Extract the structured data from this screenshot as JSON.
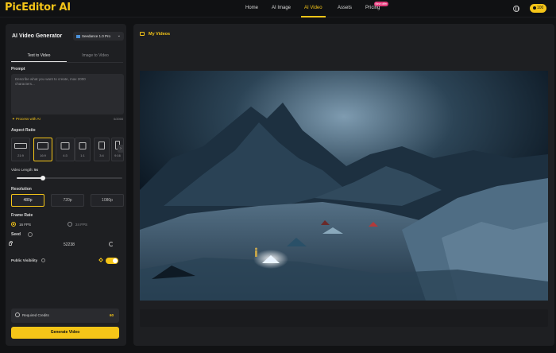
{
  "nav": {
    "logo": "PicEditor AI",
    "items": [
      {
        "label": "Home"
      },
      {
        "label": "AI Image"
      },
      {
        "label": "AI Video"
      },
      {
        "label": "Assets"
      },
      {
        "label": "Pricing"
      }
    ],
    "active_item": "AI Video",
    "pricing_badge": "New offer",
    "credits": "100"
  },
  "panel": {
    "title": "AI Video Generator",
    "model": "Seedance 1.0 Pro",
    "tabs": [
      {
        "label": "Text to Video"
      },
      {
        "label": "Image to Video"
      }
    ],
    "active_tab": "Text to Video",
    "prompt_label": "Prompt",
    "prompt_placeholder": "Describe what you want to create, max 2000 characters...",
    "prompt_counter": "0/2000",
    "process_ai": "Process with AI",
    "aspect_ratio_label": "Aspect Ratio",
    "aspect_ratios": [
      {
        "label": "21:9"
      },
      {
        "label": "16:9"
      },
      {
        "label": "4:3"
      },
      {
        "label": "1:1"
      },
      {
        "label": "3:4"
      },
      {
        "label": "9:16"
      }
    ],
    "active_ratio": "16:9",
    "video_length_label": "Video Length:",
    "video_length_value": "5s",
    "video_length_fraction": 0.25,
    "resolution_label": "Resolution",
    "resolutions": [
      {
        "label": "480p"
      },
      {
        "label": "720p"
      },
      {
        "label": "1080p"
      }
    ],
    "active_resolution": "480p",
    "frame_rate_label": "Frame Rate",
    "fps_options": [
      {
        "label": "16 FPS"
      },
      {
        "label": "24 FPS"
      }
    ],
    "active_fps": "16 FPS",
    "seed_label": "Seed",
    "seed_value": "52238",
    "public_visibility_label": "Public Visibility",
    "public_visibility_on": true,
    "required_credits_label": "Required Credits",
    "required_credits_value": "60",
    "generate_label": "Generate Video"
  },
  "main": {
    "my_videos_label": "My Videos"
  },
  "colors": {
    "accent": "#f5c518",
    "background": "#111214",
    "panel": "#1e1f22"
  }
}
